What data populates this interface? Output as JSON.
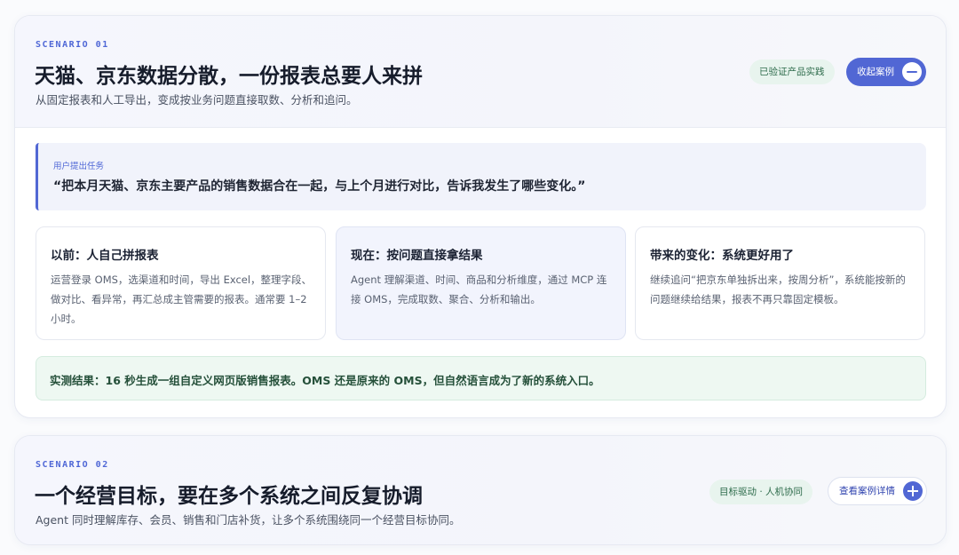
{
  "scenarios": [
    {
      "label": "SCENARIO 01",
      "title": "天猫、京东数据分散，一份报表总要人来拼",
      "subtitle": "从固定报表和人工导出，变成按业务问题直接取数、分析和追问。",
      "tag": "已验证产品实践",
      "button": "收起案例",
      "button_icon": "minus-icon",
      "task_label": "用户提出任务",
      "task_quote": "“把本月天猫、京东主要产品的销售数据合在一起，与上个月进行对比，告诉我发生了哪些变化。”",
      "columns": [
        {
          "title": "以前：人自己拼报表",
          "body": "运营登录 OMS，选渠道和时间，导出 Excel，整理字段、做对比、看异常，再汇总成主管需要的报表。通常要 1–2 小时。"
        },
        {
          "title": "现在：按问题直接拿结果",
          "body": "Agent 理解渠道、时间、商品和分析维度，通过 MCP 连接 OMS，完成取数、聚合、分析和输出。"
        },
        {
          "title": "带来的变化：系统更好用了",
          "body": "继续追问“把京东单独拆出来，按周分析”，系统能按新的问题继续给结果，报表不再只靠固定模板。"
        }
      ],
      "result": "实测结果：16 秒生成一组自定义网页版销售报表。OMS 还是原来的 OMS，但自然语言成为了新的系统入口。"
    },
    {
      "label": "SCENARIO 02",
      "title": "一个经营目标，要在多个系统之间反复协调",
      "subtitle": "Agent 同时理解库存、会员、销售和门店补货，让多个系统围绕同一个经营目标协同。",
      "tag": "目标驱动 · 人机协同",
      "button": "查看案例详情",
      "button_icon": "plus-icon"
    }
  ],
  "colors": {
    "accent": "#5167d4",
    "tag_bg": "#e8f4ee",
    "result_bg": "#eef8f2"
  }
}
